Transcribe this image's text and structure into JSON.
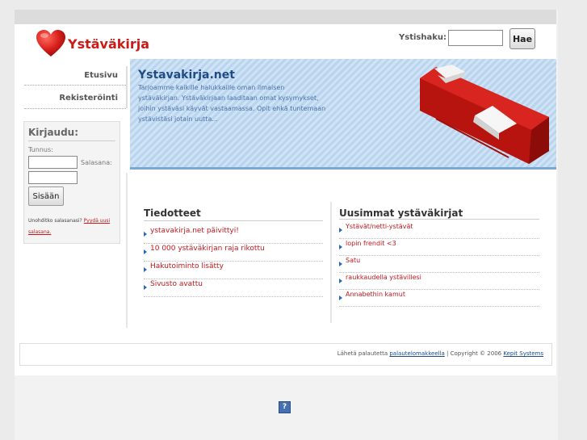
{
  "brand": {
    "name": "Ystäväkirja"
  },
  "search": {
    "label": "Ystishaku:",
    "value": "",
    "button": "Hae"
  },
  "nav": [
    {
      "label": "Etusivu"
    },
    {
      "label": "Rekisteröinti"
    }
  ],
  "login": {
    "title": "Kirjaudu:",
    "username_label": "Tunnus:",
    "password_label": "Salasana:",
    "button": "Sisään",
    "forgot_text": "Unohditko salasanasi?",
    "forgot_link": "Pyydä uusi salasana."
  },
  "banner": {
    "title": "Ystavakirja.net",
    "text": "Tarjoamme kaikille halukkaille oman ilmaisen ystäväkirjan. Ystäväkirjaan laaditaan omat kysymykset, joihin ystäväsi käyvät vastaamassa. Opit ehkä tuntemaan ystävistäsi jotain uutta..."
  },
  "news": {
    "title": "Tiedotteet",
    "items": [
      {
        "label": "ystavakirja.net päivittyi!"
      },
      {
        "label": "10 000 ystäväkirjan raja rikottu"
      },
      {
        "label": "Hakutoiminto lisätty"
      },
      {
        "label": "Sivusto avattu"
      }
    ]
  },
  "latest": {
    "title": "Uusimmat ystäväkirjat",
    "items": [
      {
        "label": "Ystävät/netti-ystävät"
      },
      {
        "label": "lopin frendit <3"
      },
      {
        "label": "Satu"
      },
      {
        "label": "raukkaudella ystävillesi"
      },
      {
        "label": "Annabethin kamut"
      }
    ]
  },
  "footer": {
    "prefix": "Lähetä palautetta",
    "feedback_link": "palautelomakkeella",
    "copyright": "| Copyright © 2006",
    "company_link": "Kepit Systems"
  },
  "help_icon": {
    "glyph": "?"
  },
  "colors": {
    "brand_red": "#cc1a16",
    "link_red": "#c4171c",
    "banner_blue": "#1e4d86",
    "bullet_blue": "#2a68b8"
  }
}
